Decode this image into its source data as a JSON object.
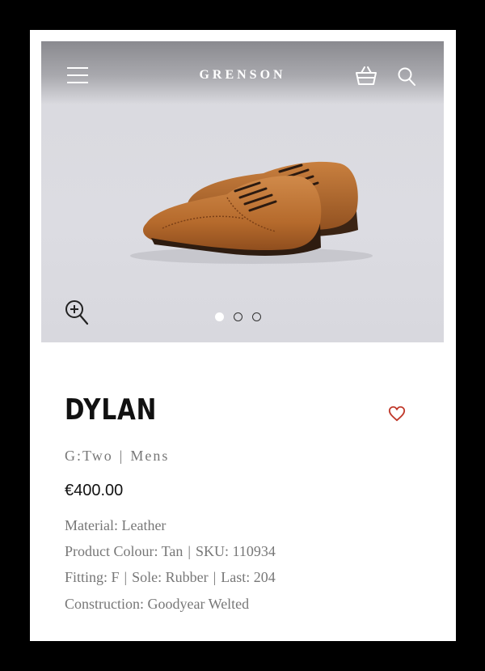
{
  "header": {
    "brand": "GRENSON"
  },
  "gallery": {
    "slide_count": 3,
    "active_slide": 1
  },
  "product": {
    "name": "DYLAN",
    "collection": "G:Two",
    "gender": "Mens",
    "price": "€400.00",
    "specs": {
      "material": "Material: Leather",
      "colour": "Product Colour: Tan",
      "sku": "SKU: 110934",
      "fitting": "Fitting: F",
      "sole": "Sole: Rubber",
      "last": "Last: 204",
      "construction": "Construction: Goodyear Welted"
    }
  },
  "colors": {
    "heart": "#c0392b",
    "text_muted": "#777777"
  },
  "icons": [
    "hamburger-menu-icon",
    "basket-icon",
    "search-icon",
    "zoom-icon",
    "heart-icon"
  ]
}
